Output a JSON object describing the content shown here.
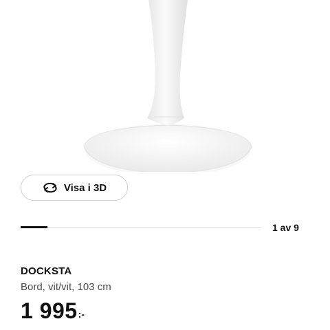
{
  "view_3d": {
    "label": "Visa i 3D",
    "icon": "rotate-3d-icon"
  },
  "gallery": {
    "counter": "1 av 9",
    "current": 1,
    "total": 9
  },
  "product": {
    "name": "DOCKSTA",
    "description": "Bord, vit/vit, 103 cm",
    "price_integer": "1 995",
    "price_decimal": ":-"
  },
  "colors": {
    "text": "#111111",
    "secondary_text": "#4a4a4a",
    "border": "#cfcfcf"
  }
}
